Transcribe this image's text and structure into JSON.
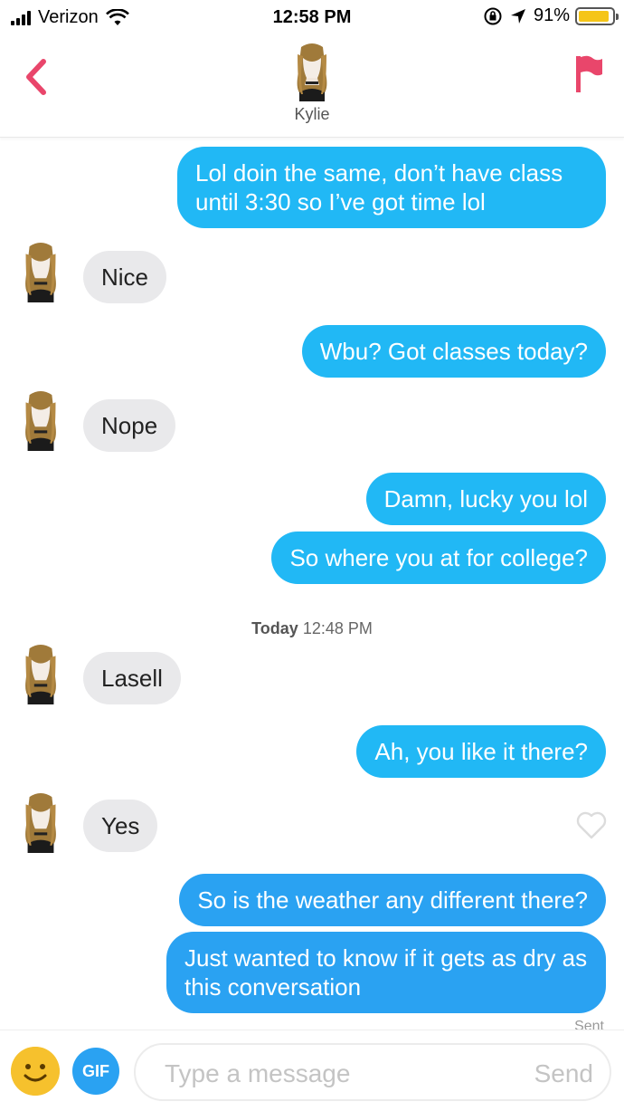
{
  "status_bar": {
    "carrier": "Verizon",
    "time": "12:58 PM",
    "battery_percent": "91%",
    "battery_level": 0.91,
    "icons": [
      "signal-icon",
      "wifi-icon",
      "orientation-lock-icon",
      "location-icon",
      "battery-icon"
    ]
  },
  "header": {
    "name": "Kylie",
    "back_icon": "chevron-left-icon",
    "report_icon": "flag-icon",
    "accent_color": "#e9466b"
  },
  "messages": [
    {
      "from": "me",
      "text": "Lol doin the same, don’t have class until 3:30 so I’ve got time lol"
    },
    {
      "from": "them",
      "text": "Nice"
    },
    {
      "from": "me",
      "text": "Wbu? Got classes today?"
    },
    {
      "from": "them",
      "text": "Nope"
    },
    {
      "from": "me",
      "text": "Damn, lucky you lol"
    },
    {
      "from": "me",
      "text": "So where you at for college?"
    },
    {
      "from": "them",
      "text": "Lasell"
    },
    {
      "from": "me",
      "text": "Ah, you like it there?"
    },
    {
      "from": "them",
      "text": "Yes"
    },
    {
      "from": "me",
      "text": "So is the weather any different there?"
    },
    {
      "from": "me",
      "text": "Just wanted to know if it gets as dry as this conversation"
    }
  ],
  "timestamp": {
    "day": "Today",
    "time": "12:48 PM"
  },
  "sent_label": "Sent",
  "composer": {
    "gif_label": "GIF",
    "placeholder": "Type a message",
    "send_label": "Send"
  },
  "colors": {
    "sent_bubble": "#21b8f5",
    "received_bubble": "#e9e9eb",
    "flag": "#e9466b"
  }
}
